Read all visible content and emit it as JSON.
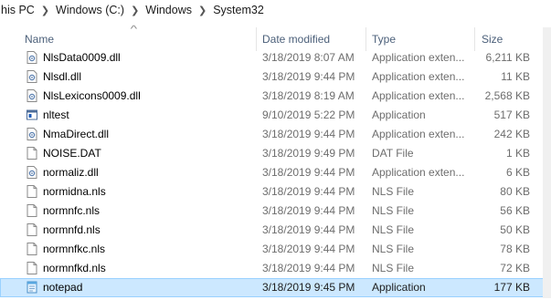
{
  "breadcrumb": [
    "his PC",
    "Windows (C:)",
    "Windows",
    "System32"
  ],
  "columns": {
    "name": "Name",
    "date": "Date modified",
    "type": "Type",
    "size": "Size"
  },
  "files": [
    {
      "name": "NlsData0009.dll",
      "date": "3/18/2019 8:07 AM",
      "type": "Application exten...",
      "size": "6,211 KB",
      "icon": "dll-file-icon"
    },
    {
      "name": "Nlsdl.dll",
      "date": "3/18/2019 9:44 PM",
      "type": "Application exten...",
      "size": "11 KB",
      "icon": "dll-file-icon"
    },
    {
      "name": "NlsLexicons0009.dll",
      "date": "3/18/2019 8:19 AM",
      "type": "Application exten...",
      "size": "2,568 KB",
      "icon": "dll-file-icon"
    },
    {
      "name": "nltest",
      "date": "9/10/2019 5:22 PM",
      "type": "Application",
      "size": "517 KB",
      "icon": "application-icon"
    },
    {
      "name": "NmaDirect.dll",
      "date": "3/18/2019 9:44 PM",
      "type": "Application exten...",
      "size": "242 KB",
      "icon": "dll-file-icon"
    },
    {
      "name": "NOISE.DAT",
      "date": "3/18/2019 9:49 PM",
      "type": "DAT File",
      "size": "1 KB",
      "icon": "generic-file-icon"
    },
    {
      "name": "normaliz.dll",
      "date": "3/18/2019 9:44 PM",
      "type": "Application exten...",
      "size": "6 KB",
      "icon": "dll-file-icon"
    },
    {
      "name": "normidna.nls",
      "date": "3/18/2019 9:44 PM",
      "type": "NLS File",
      "size": "80 KB",
      "icon": "generic-file-icon"
    },
    {
      "name": "normnfc.nls",
      "date": "3/18/2019 9:44 PM",
      "type": "NLS File",
      "size": "56 KB",
      "icon": "generic-file-icon"
    },
    {
      "name": "normnfd.nls",
      "date": "3/18/2019 9:44 PM",
      "type": "NLS File",
      "size": "50 KB",
      "icon": "generic-file-icon"
    },
    {
      "name": "normnfkc.nls",
      "date": "3/18/2019 9:44 PM",
      "type": "NLS File",
      "size": "78 KB",
      "icon": "generic-file-icon"
    },
    {
      "name": "normnfkd.nls",
      "date": "3/18/2019 9:44 PM",
      "type": "NLS File",
      "size": "72 KB",
      "icon": "generic-file-icon"
    },
    {
      "name": "notepad",
      "date": "3/18/2019 9:45 PM",
      "type": "Application",
      "size": "177 KB",
      "icon": "notepad-icon",
      "selected": true
    }
  ],
  "colors": {
    "selection": "#cce8ff",
    "selection_border": "#99d1ff",
    "header_text": "#4c607a"
  }
}
